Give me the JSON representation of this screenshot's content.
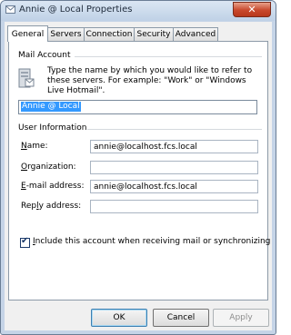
{
  "window": {
    "title": "Annie @ Local Properties",
    "close_glyph": "✕"
  },
  "tabs": [
    {
      "label": "General"
    },
    {
      "label": "Servers"
    },
    {
      "label": "Connection"
    },
    {
      "label": "Security"
    },
    {
      "label": "Advanced"
    }
  ],
  "mail_account": {
    "heading": "Mail Account",
    "description": "Type the name by which you would like to refer to these servers.  For example: \"Work\" or \"Windows Live Hotmail\".",
    "account_name": "Annie @ Local",
    "icon": "server-icon"
  },
  "user_info": {
    "heading": "User Information",
    "name_label_prefix": "",
    "name_label_key": "N",
    "name_label_rest": "ame:",
    "name_value": "annie@localhost.fcs.local",
    "org_label_prefix": "",
    "org_label_key": "O",
    "org_label_rest": "rganization:",
    "org_value": "",
    "email_label_prefix": "",
    "email_label_key": "E",
    "email_label_rest": "-mail address:",
    "email_value": "annie@localhost.fcs.local",
    "reply_label_prefix": "Rep",
    "reply_label_key": "l",
    "reply_label_rest": "y address:",
    "reply_value": ""
  },
  "include_option": {
    "label_prefix": "",
    "label_key": "I",
    "label_rest": "nclude this account when receiving mail or synchronizing",
    "checked": true,
    "check_glyph": "✔"
  },
  "buttons": {
    "ok": "OK",
    "cancel": "Cancel",
    "apply": "Apply"
  },
  "colors": {
    "selection": "#3399ff",
    "title_bar": "#c5d4e7",
    "close_button": "#c8482c"
  }
}
